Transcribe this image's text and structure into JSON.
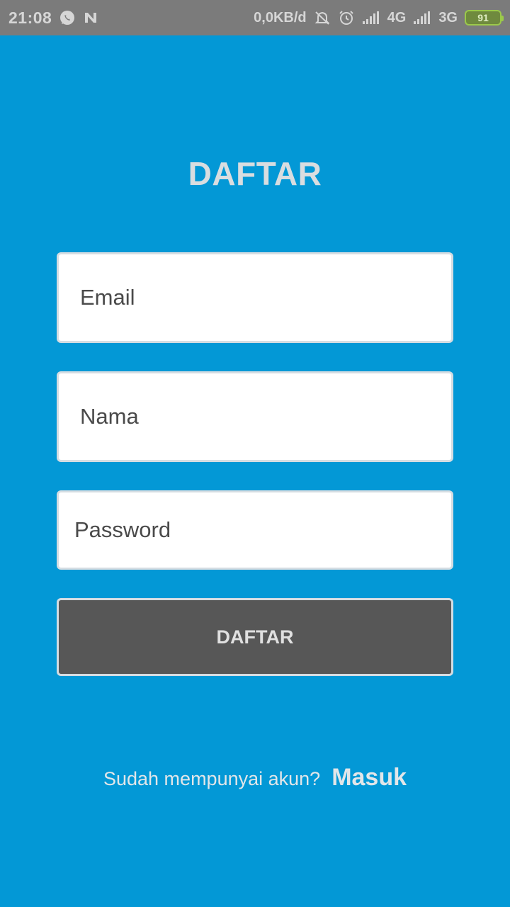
{
  "status_bar": {
    "time": "21:08",
    "speed": "0,0KB/d",
    "net1": "4G",
    "net2": "3G",
    "battery": "91",
    "icons": [
      "whatsapp-icon",
      "n-notification-icon",
      "bell-off-icon",
      "alarm-icon",
      "signal-icon",
      "signal-icon"
    ]
  },
  "title": "DAFTAR",
  "form": {
    "email_placeholder": "Email",
    "nama_placeholder": "Nama",
    "password_placeholder": "Password",
    "submit_label": "DAFTAR"
  },
  "footer": {
    "prompt": "Sudah mempunyai akun?",
    "link": "Masuk"
  },
  "colors": {
    "background": "#0398d6",
    "button": "#575757",
    "status_bar": "#7b7b7b"
  }
}
